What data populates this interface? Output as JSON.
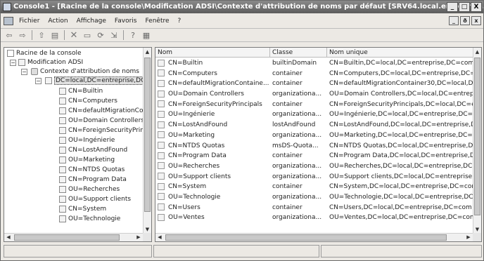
{
  "window": {
    "title": "Console1 - [Racine de la console\\Modification ADSI\\Contexte d'attribution de noms par défaut [SRV64.local.entreprise.c...",
    "buttons": {
      "minimize": "_",
      "maximize": "□",
      "close": "X"
    }
  },
  "menu": {
    "items": [
      "Fichier",
      "Action",
      "Affichage",
      "Favoris",
      "Fenêtre",
      "?"
    ],
    "inner_buttons": {
      "minimize": "_",
      "restore": "ð",
      "close": "x"
    }
  },
  "tree": {
    "nodes": [
      {
        "label": "Racine de la console",
        "icon": "folder-icon"
      },
      {
        "label": "Modification ADSI",
        "icon": "adsi-icon"
      },
      {
        "label": "Contexte d'attribution de noms",
        "icon": "database-icon"
      },
      {
        "label": "DC=local,DC=entreprise,DC",
        "icon": "folder-icon"
      },
      {
        "label": "CN=Builtin",
        "icon": "folder-icon"
      },
      {
        "label": "CN=Computers",
        "icon": "folder-icon"
      },
      {
        "label": "CN=defaultMigrationCo",
        "icon": "folder-icon"
      },
      {
        "label": "OU=Domain Controllers",
        "icon": "folder-icon"
      },
      {
        "label": "CN=ForeignSecurityPrin",
        "icon": "folder-icon"
      },
      {
        "label": "OU=Ingénierie",
        "icon": "folder-icon"
      },
      {
        "label": "CN=LostAndFound",
        "icon": "folder-icon"
      },
      {
        "label": "OU=Marketing",
        "icon": "folder-icon"
      },
      {
        "label": "CN=NTDS Quotas",
        "icon": "folder-icon"
      },
      {
        "label": "CN=Program Data",
        "icon": "folder-icon"
      },
      {
        "label": "OU=Recherches",
        "icon": "folder-icon"
      },
      {
        "label": "OU=Support clients",
        "icon": "folder-icon"
      },
      {
        "label": "CN=System",
        "icon": "folder-icon"
      },
      {
        "label": "OU=Technologie",
        "icon": "folder-icon"
      }
    ]
  },
  "list": {
    "columns": [
      "Nom",
      "Classe",
      "Nom unique"
    ],
    "rows": [
      {
        "nom": "CN=Builtin",
        "classe": "builtinDomain",
        "dn": "CN=Builtin,DC=local,DC=entreprise,DC=com"
      },
      {
        "nom": "CN=Computers",
        "classe": "container",
        "dn": "CN=Computers,DC=local,DC=entreprise,DC=c"
      },
      {
        "nom": "CN=defaultMigrationContaine...",
        "classe": "container",
        "dn": "CN=defaultMigrationContainer30,DC=local,DC="
      },
      {
        "nom": "OU=Domain Controllers",
        "classe": "organizationa...",
        "dn": "OU=Domain Controllers,DC=local,DC=entrepris"
      },
      {
        "nom": "CN=ForeignSecurityPrincipals",
        "classe": "container",
        "dn": "CN=ForeignSecurityPrincipals,DC=local,DC=ent"
      },
      {
        "nom": "OU=Ingénierie",
        "classe": "organizationa...",
        "dn": "OU=Ingénierie,DC=local,DC=entreprise,DC=c"
      },
      {
        "nom": "CN=LostAndFound",
        "classe": "lostAndFound",
        "dn": "CN=LostAndFound,DC=local,DC=entreprise,DC"
      },
      {
        "nom": "OU=Marketing",
        "classe": "organizationa...",
        "dn": "OU=Marketing,DC=local,DC=entreprise,DC=co"
      },
      {
        "nom": "CN=NTDS Quotas",
        "classe": "msDS-Quota...",
        "dn": "CN=NTDS Quotas,DC=local,DC=entreprise,DC"
      },
      {
        "nom": "CN=Program Data",
        "classe": "container",
        "dn": "CN=Program Data,DC=local,DC=entreprise,DC"
      },
      {
        "nom": "OU=Recherches",
        "classe": "organizationa...",
        "dn": "OU=Recherches,DC=local,DC=entreprise,DC="
      },
      {
        "nom": "OU=Support clients",
        "classe": "organizationa...",
        "dn": "OU=Support clients,DC=local,DC=entreprise,D"
      },
      {
        "nom": "CN=System",
        "classe": "container",
        "dn": "CN=System,DC=local,DC=entreprise,DC=com"
      },
      {
        "nom": "OU=Technologie",
        "classe": "organizationa...",
        "dn": "OU=Technologie,DC=local,DC=entreprise,DC="
      },
      {
        "nom": "CN=Users",
        "classe": "container",
        "dn": "CN=Users,DC=local,DC=entreprise,DC=com"
      },
      {
        "nom": "OU=Ventes",
        "classe": "organizationa...",
        "dn": "OU=Ventes,DC=local,DC=entreprise,DC=com"
      }
    ]
  },
  "toolbar": {
    "icons": [
      "back-icon",
      "forward-icon",
      "up-icon",
      "show-hide-tree-icon",
      "delete-icon",
      "properties-icon",
      "refresh-icon",
      "export-icon",
      "help-icon",
      "show-hide-action-pane-icon"
    ]
  },
  "colors": {
    "titlebar": "#5c5c5c",
    "selection": "#e0e0e0"
  }
}
